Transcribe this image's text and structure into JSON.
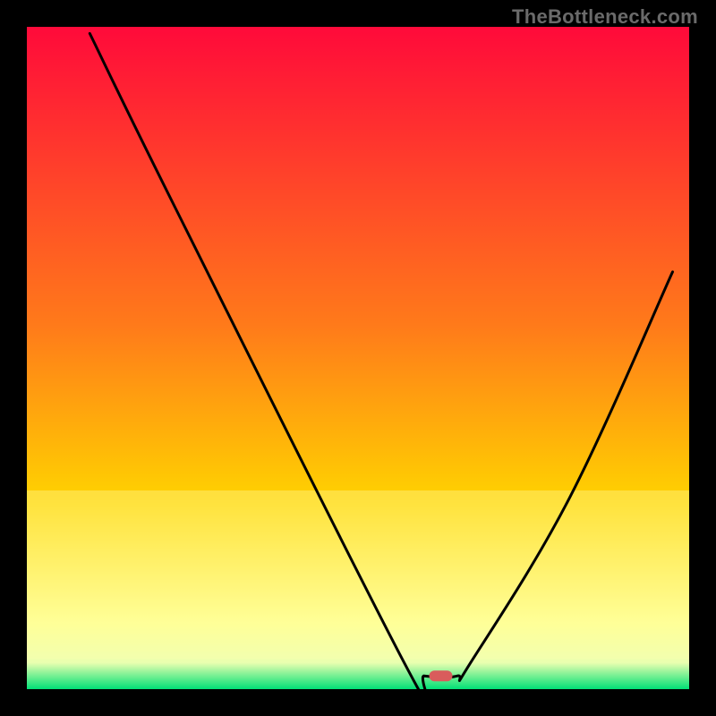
{
  "watermark": "TheBottleneck.com",
  "chart_data": {
    "type": "line",
    "title": "",
    "xlabel": "",
    "ylabel": "",
    "xlim": [
      0,
      100
    ],
    "ylim": [
      0,
      100
    ],
    "background": {
      "top_color": "#ff0a3a",
      "mid_color": "#ffd400",
      "green_band_color": "#00e076",
      "green_band_y_fraction_top": 0.955,
      "yellow_fade_y_fraction_top": 0.7
    },
    "marker": {
      "x": 62.5,
      "y": 2,
      "color": "#d95c5c"
    },
    "series": [
      {
        "name": "bottleneck-curve",
        "color": "#000000",
        "points": [
          {
            "x": 9.5,
            "y": 99.0
          },
          {
            "x": 22.5,
            "y": 72.5
          },
          {
            "x": 57.5,
            "y": 3.0
          },
          {
            "x": 60.0,
            "y": 2.0
          },
          {
            "x": 65.0,
            "y": 2.0
          },
          {
            "x": 67.0,
            "y": 4.0
          },
          {
            "x": 82.0,
            "y": 29.0
          },
          {
            "x": 97.5,
            "y": 63.0
          }
        ]
      }
    ]
  }
}
